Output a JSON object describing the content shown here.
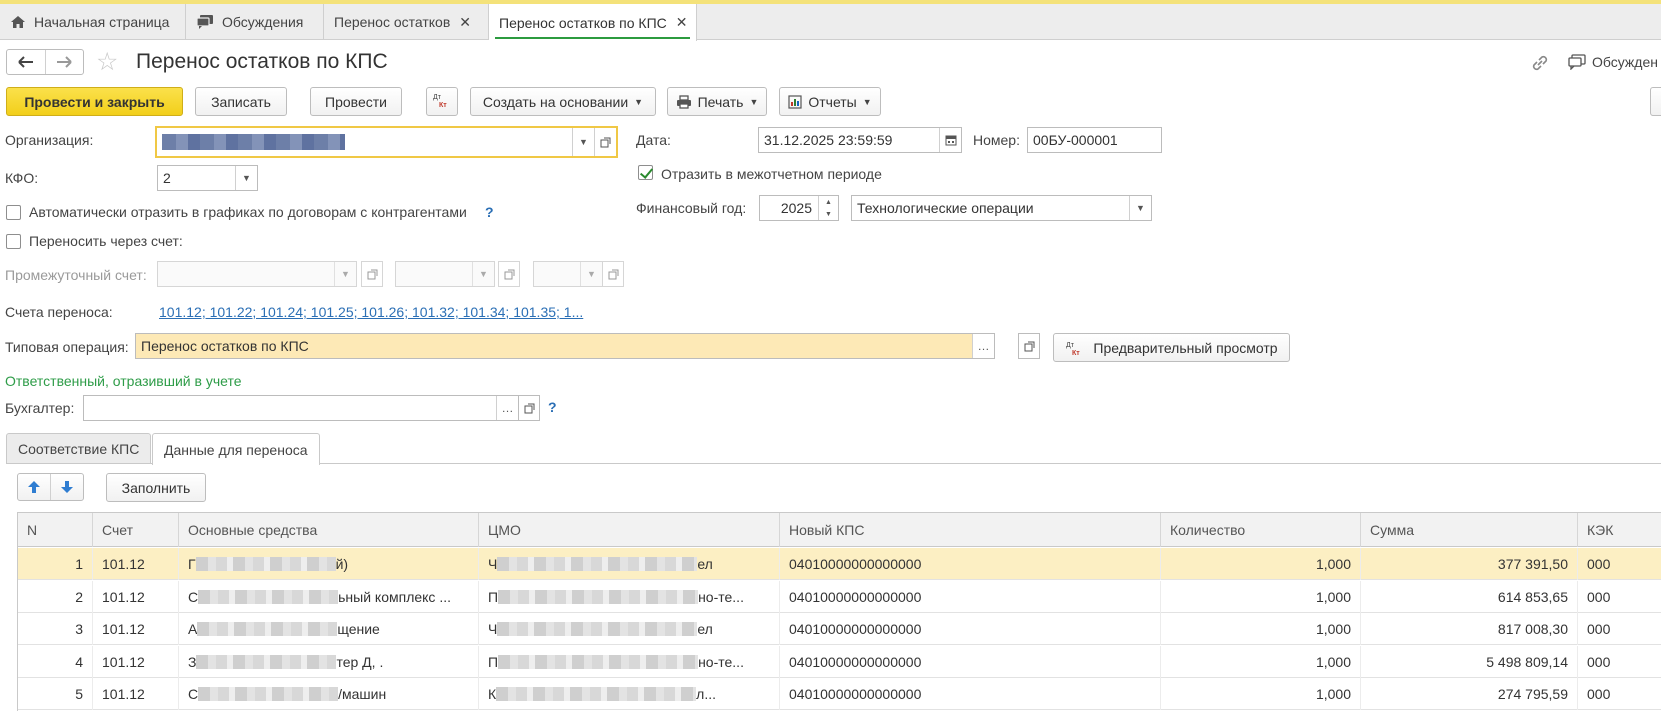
{
  "tabs": [
    {
      "label": "Начальная страница",
      "icon": "home-icon"
    },
    {
      "label": "Обсуждения",
      "icon": "discussion-icon"
    },
    {
      "label": "Перенос остатков",
      "closable": true
    },
    {
      "label": "Перенос остатков по КПС",
      "closable": true,
      "active": true
    }
  ],
  "header": {
    "title": "Перенос остатков по КПС",
    "discussions_label": "Обсужден"
  },
  "toolbar": {
    "post_close": "Провести и закрыть",
    "save": "Записать",
    "post": "Провести",
    "create_based": "Создать на основании",
    "print": "Печать",
    "reports": "Отчеты"
  },
  "form": {
    "org_label": "Организация:",
    "kfo_label": "КФО:",
    "kfo_value": "2",
    "auto_reflect_label": "Автоматически отразить в графиках по договорам с контрагентами",
    "via_account_label": "Переносить через счет:",
    "intermediate_label": "Промежуточный счет:",
    "accounts_label": "Счета переноса:",
    "accounts_value": "101.12; 101.22; 101.24; 101.25; 101.26; 101.32; 101.34; 101.35; 1...",
    "typical_op_label": "Типовая операция:",
    "typical_op_value": "Перенос остатков по КПС",
    "preview_button": "Предварительный просмотр",
    "responsible_header": "Ответственный, отразивший в учете",
    "accountant_label": "Бухгалтер:",
    "date_label": "Дата:",
    "date_value": "31.12.2025 23:59:59",
    "number_label": "Номер:",
    "number_value": "00БУ-000001",
    "interperiod_label": "Отразить в межотчетном периоде",
    "interperiod_checked": true,
    "fin_year_label": "Финансовый год:",
    "fin_year_value": "2025",
    "tech_ops_value": "Технологические операции",
    "help_mark": "?"
  },
  "inner_tabs": [
    "Соответствие КПС",
    "Данные для переноса"
  ],
  "table": {
    "fill_button": "Заполнить",
    "columns": [
      "N",
      "Счет",
      "Основные средства",
      "ЦМО",
      "Новый КПС",
      "Количество",
      "Сумма",
      "КЭК"
    ],
    "rows": [
      {
        "n": "1",
        "account": "101.12",
        "os_start": "Г",
        "os_end": "й)",
        "cmo_start": "Ч",
        "cmo_end": "ел",
        "kps": "04010000000000000",
        "qty": "1,000",
        "sum": "377 391,50",
        "kek": "000"
      },
      {
        "n": "2",
        "account": "101.12",
        "os_start": "С",
        "os_end": "ьный комплекс ...",
        "cmo_start": "П",
        "cmo_end": "но-те...",
        "kps": "04010000000000000",
        "qty": "1,000",
        "sum": "614 853,65",
        "kek": "000"
      },
      {
        "n": "3",
        "account": "101.12",
        "os_start": "А",
        "os_end": "щение",
        "cmo_start": "Ч",
        "cmo_end": "ел",
        "kps": "04010000000000000",
        "qty": "1,000",
        "sum": "817 008,30",
        "kek": "000"
      },
      {
        "n": "4",
        "account": "101.12",
        "os_start": "З",
        "os_end": "тер Д,         .",
        "cmo_start": "П",
        "cmo_end": "но-те...",
        "kps": "04010000000000000",
        "qty": "1,000",
        "sum": "5 498 809,14",
        "kek": "000"
      },
      {
        "n": "5",
        "account": "101.12",
        "os_start": "С",
        "os_end": "/машин",
        "cmo_start": "К",
        "cmo_end": "л...",
        "kps": "04010000000000000",
        "qty": "1,000",
        "sum": "274 795,59",
        "kek": "000"
      }
    ]
  }
}
